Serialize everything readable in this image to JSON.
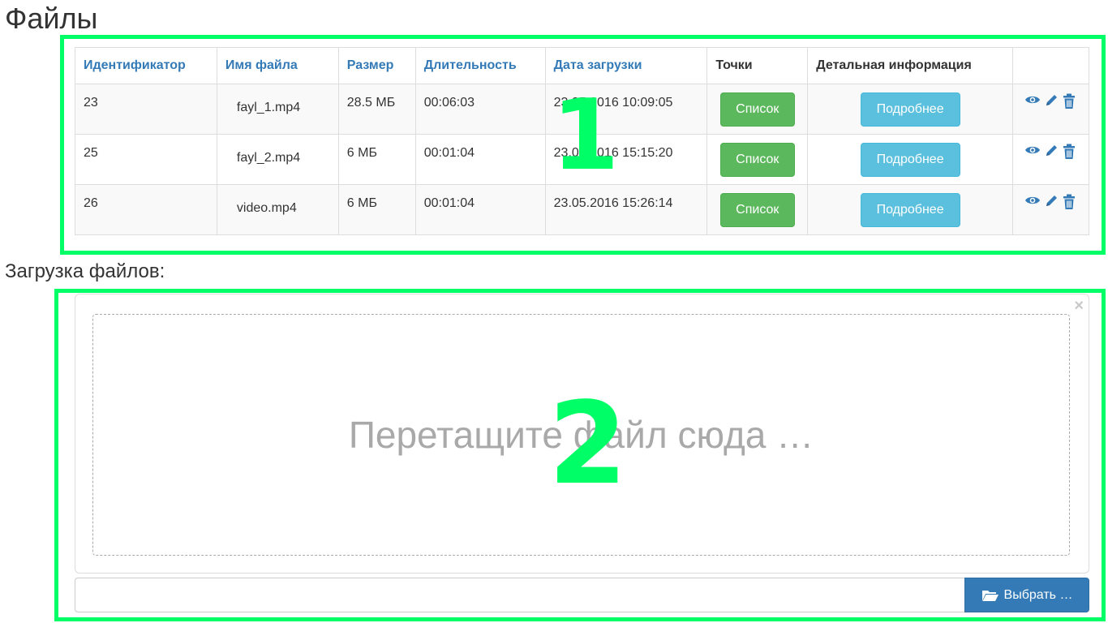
{
  "page": {
    "title": "Файлы",
    "upload_heading": "Загрузка файлов:"
  },
  "annotations": [
    "1",
    "2"
  ],
  "table": {
    "columns": [
      "Идентификатор",
      "Имя файла",
      "Размер",
      "Длительность",
      "Дата загрузки",
      "Точки",
      "Детальная информация",
      ""
    ],
    "rows": [
      {
        "id": "23",
        "name": "fayl_1.mp4",
        "size": "28.5 МБ",
        "duration": "00:06:03",
        "date": "23.05.2016 10:09:05",
        "points_btn": "Список",
        "details_btn": "Подробнее"
      },
      {
        "id": "25",
        "name": "fayl_2.mp4",
        "size": "6 МБ",
        "duration": "00:01:04",
        "date": "23.05.2016 15:15:20",
        "points_btn": "Список",
        "details_btn": "Подробнее"
      },
      {
        "id": "26",
        "name": "video.mp4",
        "size": "6 МБ",
        "duration": "00:01:04",
        "date": "23.05.2016 15:26:14",
        "points_btn": "Список",
        "details_btn": "Подробнее"
      }
    ],
    "row_icons": [
      "eye-icon",
      "pencil-icon",
      "trash-icon"
    ]
  },
  "upload": {
    "drop_text": "Перетащите файл сюда …",
    "close_symbol": "×",
    "caption_value": "",
    "browse_label": "Выбрать …",
    "browse_icon": "folder-open-icon"
  },
  "colors": {
    "link_blue": "#337ab7",
    "success_green": "#5cb85c",
    "info_blue": "#5bc0de",
    "annotation_green": "#00ff66"
  }
}
